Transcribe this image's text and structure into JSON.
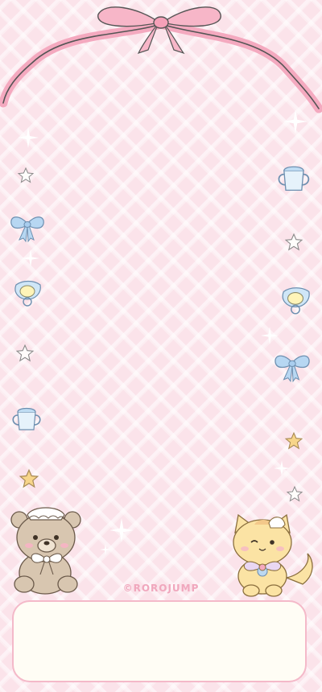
{
  "credit": {
    "text": "©ROROJUMP"
  },
  "note_card": {
    "text": ""
  },
  "decorations": {
    "ribbon": "pink-ribbon-bow",
    "left_column": [
      "sparkle-icon",
      "star-icon",
      "blue-bow-icon",
      "sparkle-icon",
      "pacifier-icon",
      "star-icon",
      "baby-cup-icon",
      "yellow-star-icon"
    ],
    "right_column": [
      "sparkle-icon",
      "baby-cup-icon",
      "star-icon",
      "pacifier-icon",
      "sparkle-icon",
      "blue-bow-icon",
      "yellow-star-icon",
      "sparkle-icon",
      "star-icon"
    ],
    "characters": [
      "teddy-bear-maid",
      "yellow-kitten-maid"
    ]
  },
  "colors": {
    "background": "#fbe3ea",
    "ribbon": "#f4a9bf",
    "accent_blue": "#a9cdee",
    "star_yellow": "#f7d58a",
    "credit_text": "#f0a7bd",
    "card_fill": "#fffdf5",
    "card_border": "#f4b9c9"
  }
}
